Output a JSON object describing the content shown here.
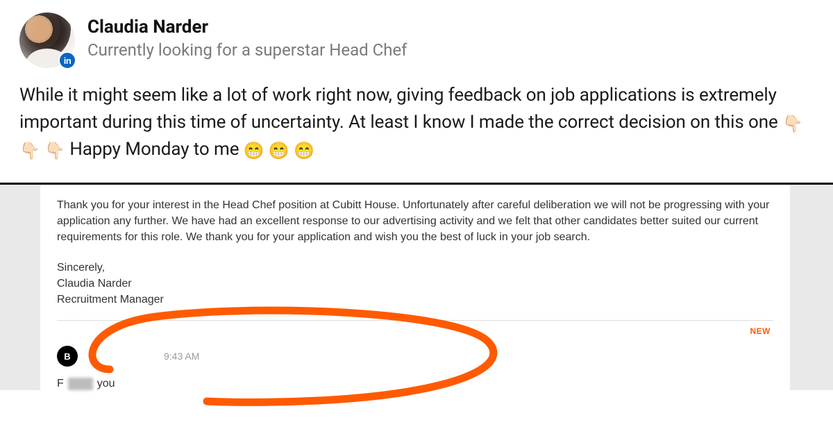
{
  "post": {
    "author_name": "Claudia Narder",
    "author_headline": "Currently looking for a superstar Head Chef",
    "linkedin_badge_text": "in",
    "body_pre": "While it might seem like a lot of work right now, giving feedback on job applications is extremely important during this time of uncertainty. At least I know I made the correct decision on this one ",
    "emoji_down": "👇🏻",
    "body_mid": " Happy Monday to me ",
    "emoji_grin": "😁"
  },
  "email": {
    "body": "Thank you for your interest in the Head Chef position at Cubitt House. Unfortunately after careful deliberation we will not be progressing with your application any further. We have had an excellent response to our advertising activity and we felt that other candidates better suited our current requirements for this role. We thank you for your application and wish you the best of luck in your job search.",
    "sig_closing": "Sincerely,",
    "sig_name": "Claudia Narder",
    "sig_title": "Recruitment Manager",
    "new_label": "NEW",
    "reply_avatar_letter": "B",
    "reply_time": "9:43 AM",
    "reply_prefix": "F",
    "reply_suffix": "you"
  }
}
